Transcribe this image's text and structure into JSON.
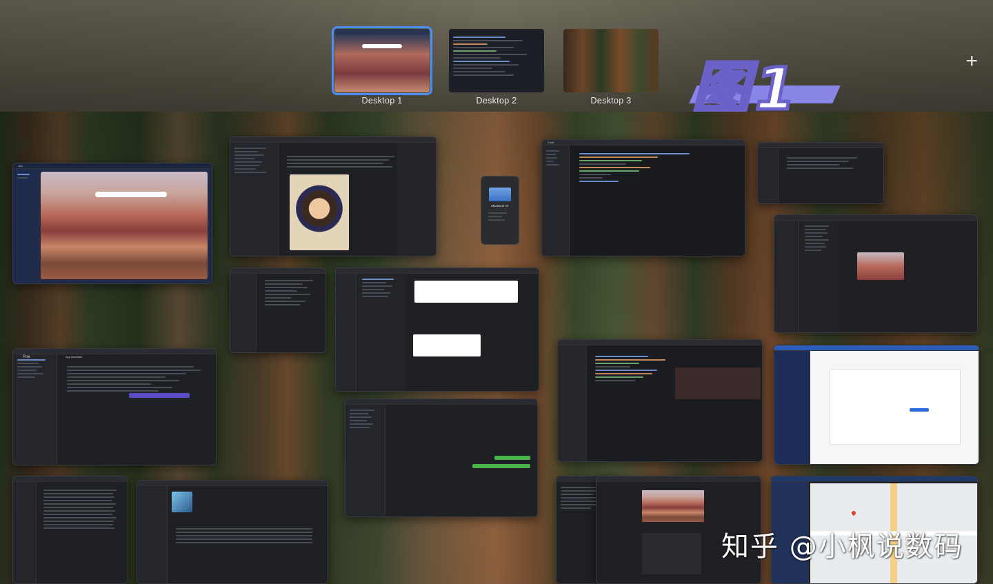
{
  "spaces": [
    {
      "label": "Desktop 1",
      "active": true
    },
    {
      "label": "Desktop 2",
      "active": false
    },
    {
      "label": "Desktop 3",
      "active": false
    }
  ],
  "add_space_symbol": "+",
  "badge": {
    "text": "图1"
  },
  "watermark": "知乎 @小枫说数码",
  "windows": {
    "browser": {
      "title": "Arc"
    },
    "poe": {
      "title": "Poe",
      "header_name": "App Assistant",
      "input_hint": "Discover"
    },
    "about_mac": {
      "model": "MacBook Air"
    },
    "code_editor": {
      "title": "Code"
    }
  },
  "colors": {
    "active_space_outline": "#4a8ef5",
    "badge_purple": "#8a86e8"
  }
}
